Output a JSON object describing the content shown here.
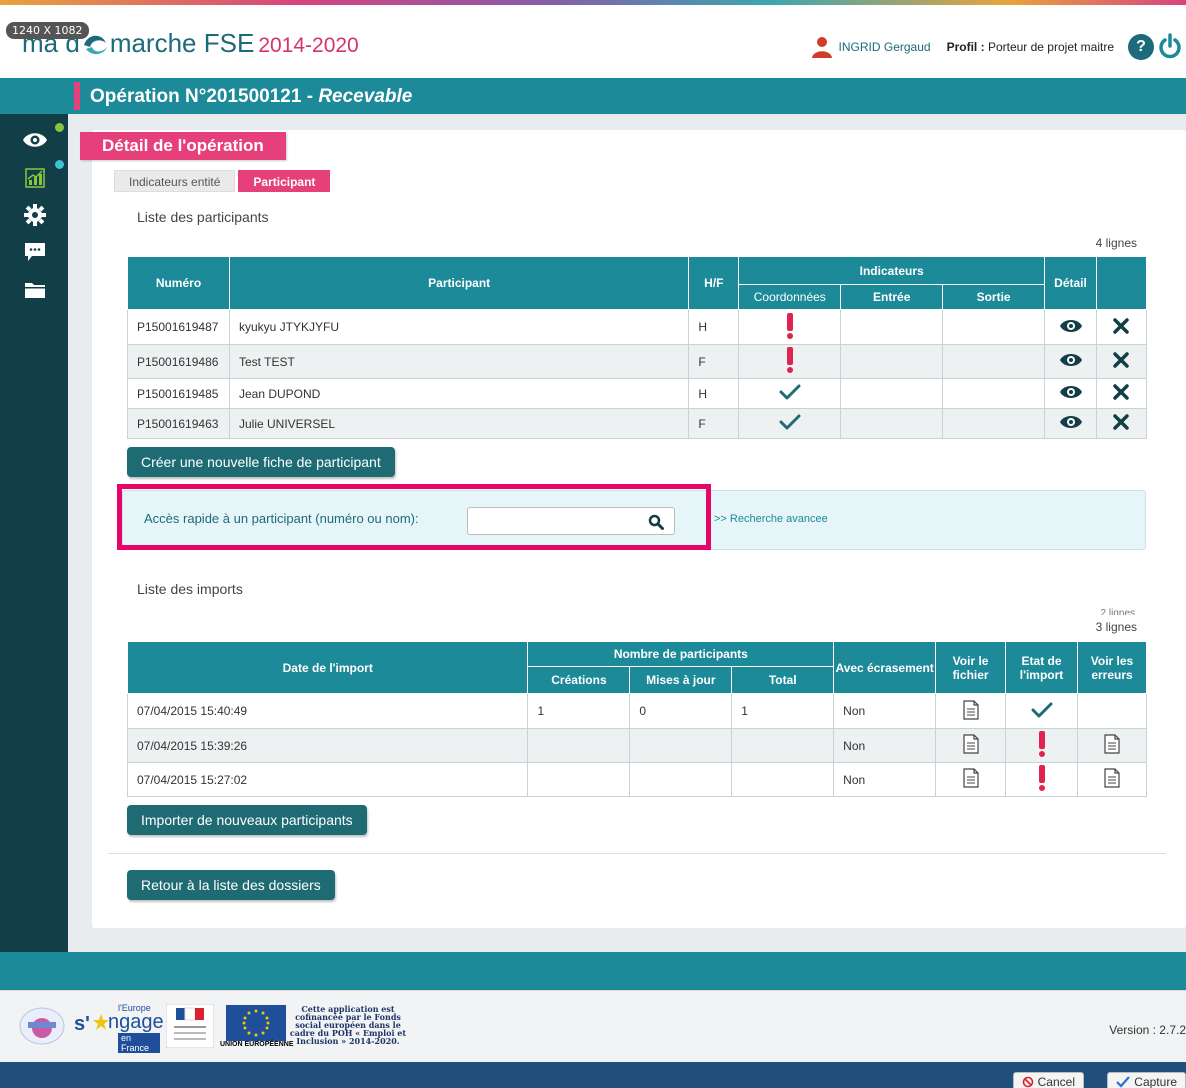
{
  "screen_badge": "1240 X 1082",
  "app": {
    "logo_text_1": "ma d",
    "logo_text_2": "marche FSE",
    "logo_years": "2014-2020"
  },
  "user": {
    "name": "INGRID Gergaud",
    "profile_label": "Profil :",
    "profile_value": "Porteur de projet maitre",
    "help_label": "?"
  },
  "page": {
    "operation_title": "Opération N°201500121 - ",
    "status": "Recevable"
  },
  "card": {
    "title": "Détail de l'opération"
  },
  "tabs": [
    {
      "label": "Indicateurs entité"
    },
    {
      "label": "Participant"
    }
  ],
  "participants": {
    "section_title": "Liste des participants",
    "count": "4 lignes",
    "headers": {
      "numero": "Numéro",
      "participant": "Participant",
      "hf": "H/F",
      "indicateurs": "Indicateurs",
      "coordonnees": "Coordonnées",
      "entree": "Entrée",
      "sortie": "Sortie",
      "detail": "Détail"
    },
    "rows": [
      {
        "numero": "P15001619487",
        "participant": "kyukyu JTYKJYFU",
        "hf": "H",
        "coordonnees": "warning"
      },
      {
        "numero": "P15001619486",
        "participant": "Test TEST",
        "hf": "F",
        "coordonnees": "warning"
      },
      {
        "numero": "P15001619485",
        "participant": "Jean DUPOND",
        "hf": "H",
        "coordonnees": "check"
      },
      {
        "numero": "P15001619463",
        "participant": "Julie UNIVERSEL",
        "hf": "F",
        "coordonnees": "check"
      }
    ],
    "create_button": "Créer une nouvelle fiche de participant"
  },
  "quick_access": {
    "label": "Accès rapide à un participant (numéro ou nom):",
    "input_value": "",
    "advanced_link": ">> Recherche avancee"
  },
  "imports": {
    "section_title": "Liste des imports",
    "count_ghost": "2 lignes",
    "count": "3 lignes",
    "headers": {
      "date": "Date de l'import",
      "nombre": "Nombre de participants",
      "creations": "Créations",
      "mises": "Mises à jour",
      "total": "Total",
      "avec": "Avec écrasement",
      "voir_fichier": "Voir le fichier",
      "etat": "Etat de l'import",
      "voir_erreurs": "Voir les erreurs"
    },
    "rows": [
      {
        "date": "07/04/2015 15:40:49",
        "creations": "1",
        "mises": "0",
        "total": "1",
        "avec": "Non",
        "etat": "check",
        "erreurs": false
      },
      {
        "date": "07/04/2015 15:39:26",
        "creations": "",
        "mises": "",
        "total": "",
        "avec": "Non",
        "etat": "warning",
        "erreurs": true
      },
      {
        "date": "07/04/2015 15:27:02",
        "creations": "",
        "mises": "",
        "total": "",
        "avec": "Non",
        "etat": "warning",
        "erreurs": true
      }
    ],
    "import_button": "Importer de nouveaux participants"
  },
  "back_button": "Retour à la liste des dossiers",
  "footer": {
    "version": "Version : 2.7.2",
    "europe_small": "l'Europe",
    "engage_word": "ngage",
    "en_france": "en France",
    "cofinance_text": "Cette application est cofinancée par le Fonds social européen dans le cadre du POH « Emploi et Inclusion » 2014-2020.",
    "ue_label": "UNION EUROPÉENNE"
  },
  "capture_bar": {
    "cancel": "Cancel",
    "capture": "Capture"
  },
  "colors": {
    "teal": "#1c8a98",
    "dark_teal": "#123e47",
    "pink": "#e6407a",
    "highlight": "#e6066a",
    "warning_red": "#e0234f"
  }
}
